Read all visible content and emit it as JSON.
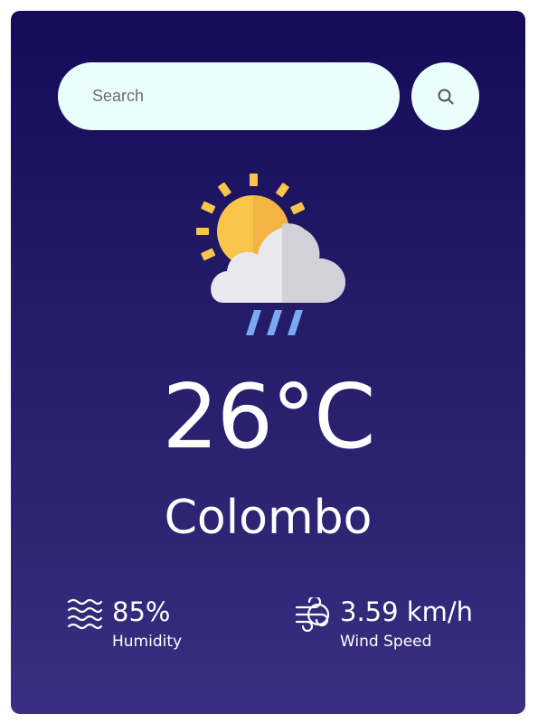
{
  "search": {
    "placeholder": "Search",
    "value": ""
  },
  "weather": {
    "icon": "sun-cloud-rain-icon",
    "temperature": "26°C",
    "city": "Colombo"
  },
  "stats": {
    "humidity": {
      "icon": "humidity-waves-icon",
      "value": "85%",
      "label": "Humidity"
    },
    "wind": {
      "icon": "wind-icon",
      "value": "3.59 km/h",
      "label": "Wind Speed"
    }
  },
  "colors": {
    "card_top": "#150b58",
    "card_bottom": "#3a2f82",
    "input_background": "#eafffb",
    "sun": "#f9c54a",
    "sun_shade": "#f3b445",
    "cloud": "#e9e8ef",
    "cloud_shade": "#d2d1d7",
    "rain": "#7aa9f3"
  }
}
